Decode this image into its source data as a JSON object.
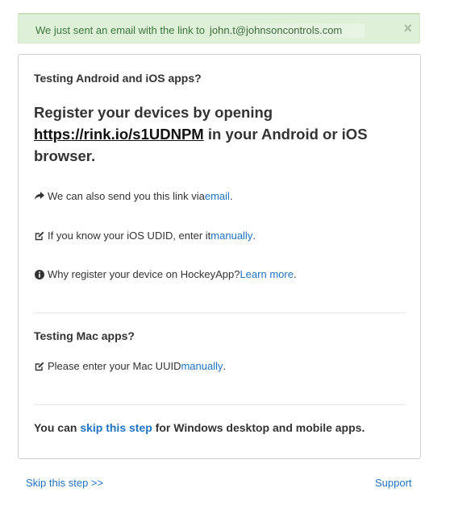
{
  "alert": {
    "message": "We just sent an email with the link to",
    "email": "john.t@johnsoncontrols.com",
    "close_glyph": "×"
  },
  "mobile": {
    "heading": "Testing Android and iOS apps?",
    "big_prefix": "Register your devices by opening",
    "big_link": "https://rink.io/s1UDNPM",
    "big_suffix": " in your Android or iOS browser.",
    "send_link_text": "We can also send you this link via ",
    "send_link_action": "email",
    "udid_text": "If you know your iOS UDID, enter it ",
    "udid_action": "manually",
    "why_text": "Why register your device on HockeyApp? ",
    "why_action": "Learn more",
    "period": "."
  },
  "mac": {
    "heading": "Testing Mac apps?",
    "uuid_text": "Please enter your Mac UUID ",
    "uuid_action": "manually",
    "period": "."
  },
  "windows": {
    "prefix": "You can ",
    "action": "skip this step",
    "suffix": " for Windows desktop and mobile apps."
  },
  "footer": {
    "skip_label": "Skip this step >>",
    "support_label": "Support"
  },
  "colors": {
    "link": "#1f73c4",
    "alert_bg": "#dff0d8",
    "alert_text": "#3c763d"
  },
  "icons": {
    "share": "share-arrow-icon",
    "edit": "edit-icon",
    "info": "info-circle-icon",
    "close": "close-icon"
  }
}
